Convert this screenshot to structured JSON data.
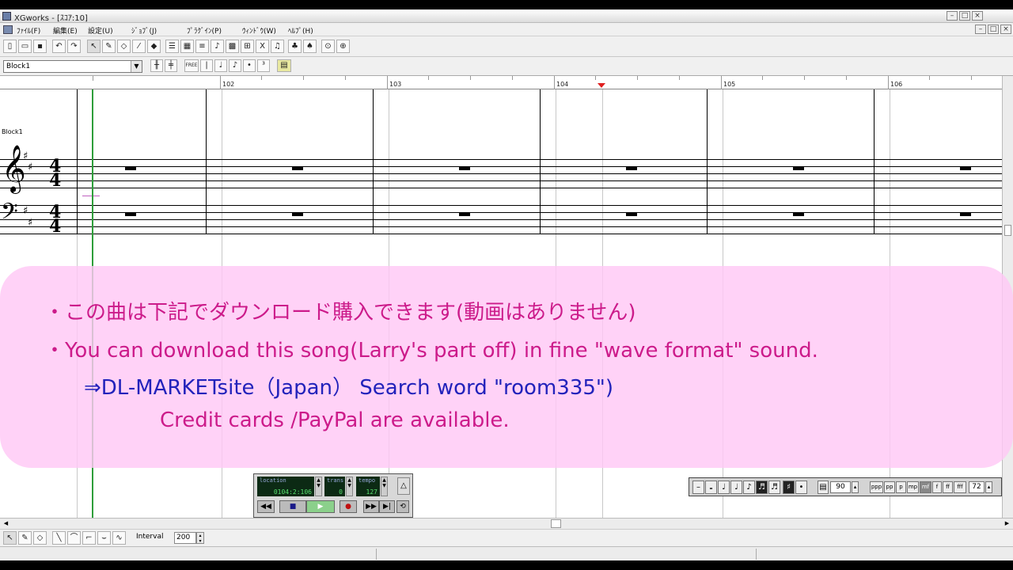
{
  "window": {
    "title": "XGworks - [ｽｺｱ:10]",
    "min": "–",
    "max": "□",
    "close": "×"
  },
  "menu": [
    "ﾌｧｲﾙ(F)",
    "編集(E)",
    "設定(U)",
    "ｼﾞｮﾌﾞ(J)",
    "ﾌﾟﾗｸﾞｲﾝ(P)",
    "ｳｨﾝﾄﾞｳ(W)",
    "ﾍﾙﾌﾟ(H)"
  ],
  "block": {
    "selector_value": "Block1",
    "track_label": "Block1"
  },
  "ruler": {
    "measures": [
      "102",
      "103",
      "104",
      "105",
      "106"
    ]
  },
  "overlay": {
    "line1": "・この曲は下記でダウンロード購入できます(動画はありません)",
    "line2": "・You can download this song(Larry's part off) in fine \"wave format\" sound.",
    "line3": "⇒DL-MARKETsite（Japan）  Search word \"room335\")",
    "line4": "Credit cards /PayPal are available."
  },
  "transport": {
    "location_label": "location",
    "location_value": "0104:2:106",
    "trans_label": "trans",
    "trans_value": "0",
    "tempo_label": "tempo",
    "tempo_value": "127"
  },
  "note_palette": {
    "velocity": "90",
    "dynamics": [
      "ppp",
      "pp",
      "p",
      "mp",
      "mf",
      "f",
      "ff",
      "fff"
    ],
    "value": "72"
  },
  "bottom": {
    "interval_label": "Interval",
    "interval_value": "200"
  },
  "colors": {
    "overlay_bg": "#ffc8f5",
    "overlay_jp_text": "#cc1b8a",
    "overlay_en_text": "#cc1b8a",
    "overlay_dl_text": "#2222bb",
    "playhead": "#2e9e3a",
    "marker": "#e02020"
  },
  "time_signature": {
    "top": "4",
    "bottom": "4"
  }
}
